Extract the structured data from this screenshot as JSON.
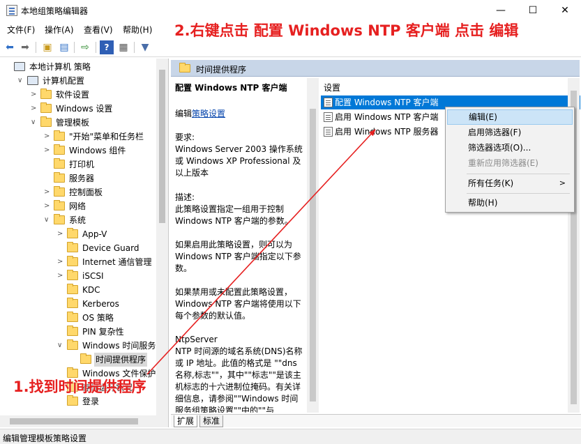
{
  "window": {
    "title": "本地组策略编辑器",
    "minimize_glyph": "—",
    "maximize_glyph": "☐",
    "close_glyph": "✕"
  },
  "menu": [
    "文件(F)",
    "操作(A)",
    "查看(V)",
    "帮助(H)"
  ],
  "toolbar_icons": [
    "back-arrow-icon",
    "forward-arrow-icon",
    "up-folder-icon",
    "show-hide-tree-icon",
    "export-list-icon",
    "help-icon",
    "properties-icon",
    "filter-icon"
  ],
  "tree": [
    {
      "label": "本地计算机 策略",
      "depth": 0,
      "toggle": "",
      "icon": "computer-icon"
    },
    {
      "label": "计算机配置",
      "depth": 1,
      "toggle": "∨",
      "icon": "computer-icon"
    },
    {
      "label": "软件设置",
      "depth": 2,
      "toggle": ">",
      "icon": "folder-icon"
    },
    {
      "label": "Windows 设置",
      "depth": 2,
      "toggle": ">",
      "icon": "folder-icon"
    },
    {
      "label": "管理模板",
      "depth": 2,
      "toggle": "∨",
      "icon": "folder-icon"
    },
    {
      "label": "\"开始\"菜单和任务栏",
      "depth": 3,
      "toggle": ">",
      "icon": "folder-icon"
    },
    {
      "label": "Windows 组件",
      "depth": 3,
      "toggle": ">",
      "icon": "folder-icon"
    },
    {
      "label": "打印机",
      "depth": 3,
      "toggle": "",
      "icon": "folder-icon"
    },
    {
      "label": "服务器",
      "depth": 3,
      "toggle": "",
      "icon": "folder-icon"
    },
    {
      "label": "控制面板",
      "depth": 3,
      "toggle": ">",
      "icon": "folder-icon"
    },
    {
      "label": "网络",
      "depth": 3,
      "toggle": ">",
      "icon": "folder-icon"
    },
    {
      "label": "系统",
      "depth": 3,
      "toggle": "∨",
      "icon": "folder-icon"
    },
    {
      "label": "App-V",
      "depth": 4,
      "toggle": ">",
      "icon": "folder-icon"
    },
    {
      "label": "Device Guard",
      "depth": 4,
      "toggle": "",
      "icon": "folder-icon"
    },
    {
      "label": "Internet 通信管理",
      "depth": 4,
      "toggle": ">",
      "icon": "folder-icon"
    },
    {
      "label": "iSCSI",
      "depth": 4,
      "toggle": ">",
      "icon": "folder-icon"
    },
    {
      "label": "KDC",
      "depth": 4,
      "toggle": "",
      "icon": "folder-icon"
    },
    {
      "label": "Kerberos",
      "depth": 4,
      "toggle": "",
      "icon": "folder-icon"
    },
    {
      "label": "OS 策略",
      "depth": 4,
      "toggle": "",
      "icon": "folder-icon"
    },
    {
      "label": "PIN 复杂性",
      "depth": 4,
      "toggle": "",
      "icon": "folder-icon"
    },
    {
      "label": "Windows 时间服务",
      "depth": 4,
      "toggle": "∨",
      "icon": "folder-icon"
    },
    {
      "label": "时间提供程序",
      "depth": 5,
      "toggle": "",
      "icon": "folder-icon",
      "selected": true
    },
    {
      "label": "Windows 文件保护",
      "depth": 4,
      "toggle": "",
      "icon": "folder-icon"
    },
    {
      "label": "存储运行状况",
      "depth": 4,
      "toggle": "",
      "icon": "folder-icon"
    },
    {
      "label": "登录",
      "depth": 4,
      "toggle": "",
      "icon": "folder-icon"
    }
  ],
  "right_header": "时间提供程序",
  "description": {
    "title": "配置 Windows NTP 客户端",
    "edit_prefix": "编辑",
    "edit_link": "策略设置",
    "requirements_label": "要求:",
    "requirements_text": "Windows Server 2003 操作系统或 Windows XP Professional 及以上版本",
    "desc_label": "描述:",
    "desc_text": "此策略设置指定一组用于控制 Windows NTP 客户端的参数。",
    "enabled_text": "如果启用此策略设置，则可以为 Windows NTP 客户端指定以下参数。",
    "disabled_text": "如果禁用或未配置此策略设置，Windows NTP 客户端将使用以下每个参数的默认值。",
    "ntpserver_label": "NtpServer",
    "ntpserver_text": "NTP 时间源的域名系统(DNS)名称或 IP 地址。此值的格式是 \"\"dns 名称,标志\"\"，其中\"\"标志\"\"是该主机标志的十六进制位掩码。有关详细信息，请参阅\"\"Windows 时间服务组策略设置\"\"中的\"\"与"
  },
  "settings": {
    "header": "设置",
    "rows": [
      {
        "label": "配置 Windows NTP 客户端",
        "selected": true
      },
      {
        "label": "启用 Windows NTP 客户端",
        "selected": false
      },
      {
        "label": "启用 Windows NTP 服务器",
        "selected": false
      }
    ]
  },
  "context_menu": {
    "items": [
      {
        "label": "编辑(E)",
        "highlighted": true,
        "disabled": false
      },
      {
        "label": "启用筛选器(F)",
        "highlighted": false,
        "disabled": false
      },
      {
        "label": "筛选器选项(O)...",
        "highlighted": false,
        "disabled": false
      },
      {
        "label": "重新应用筛选器(E)",
        "highlighted": false,
        "disabled": true
      },
      {
        "label": "所有任务(K)",
        "highlighted": false,
        "disabled": false,
        "submenu": true
      },
      {
        "label": "帮助(H)",
        "highlighted": false,
        "disabled": false
      }
    ],
    "submenu_arrow": ">"
  },
  "tabs": [
    "扩展",
    "标准"
  ],
  "status": "编辑管理模板策略设置",
  "annotations": {
    "top": "2.右键点击 配置 Windows NTP 客户端 点击 编辑",
    "bottom": "1.找到时间提供程序",
    "color": "#e62020"
  },
  "colors": {
    "selection_blue": "#0078d7",
    "header_blue": "#c8d6e8",
    "menu_highlight": "#cce4f7",
    "link": "#0645ad"
  }
}
